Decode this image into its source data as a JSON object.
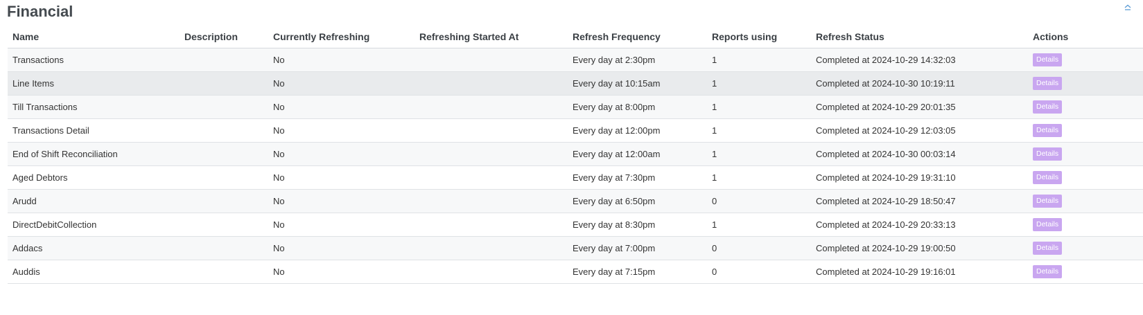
{
  "section": {
    "title": "Financial",
    "collapse_icon": "chevron-up-icon"
  },
  "colors": {
    "button": "#c9a6f0",
    "title": "#444a4f",
    "row_alt": "#f7f8f9",
    "row_hover": "#e9ebed"
  },
  "table": {
    "headers": [
      "Name",
      "Description",
      "Currently Refreshing",
      "Refreshing Started At",
      "Refresh Frequency",
      "Reports using",
      "Refresh Status",
      "Actions"
    ],
    "rows": [
      {
        "name": "Transactions",
        "description": "",
        "refreshing": "No",
        "started": "",
        "frequency": "Every day at 2:30pm",
        "reports": "1",
        "status": "Completed at 2024-10-29 14:32:03",
        "action": "Details"
      },
      {
        "name": "Line Items",
        "description": "",
        "refreshing": "No",
        "started": "",
        "frequency": "Every day at 10:15am",
        "reports": "1",
        "status": "Completed at 2024-10-30 10:19:11",
        "action": "Details"
      },
      {
        "name": "Till Transactions",
        "description": "",
        "refreshing": "No",
        "started": "",
        "frequency": "Every day at 8:00pm",
        "reports": "1",
        "status": "Completed at 2024-10-29 20:01:35",
        "action": "Details"
      },
      {
        "name": "Transactions Detail",
        "description": "",
        "refreshing": "No",
        "started": "",
        "frequency": "Every day at 12:00pm",
        "reports": "1",
        "status": "Completed at 2024-10-29 12:03:05",
        "action": "Details"
      },
      {
        "name": "End of Shift Reconciliation",
        "description": "",
        "refreshing": "No",
        "started": "",
        "frequency": "Every day at 12:00am",
        "reports": "1",
        "status": "Completed at 2024-10-30 00:03:14",
        "action": "Details"
      },
      {
        "name": "Aged Debtors",
        "description": "",
        "refreshing": "No",
        "started": "",
        "frequency": "Every day at 7:30pm",
        "reports": "1",
        "status": "Completed at 2024-10-29 19:31:10",
        "action": "Details"
      },
      {
        "name": "Arudd",
        "description": "",
        "refreshing": "No",
        "started": "",
        "frequency": "Every day at 6:50pm",
        "reports": "0",
        "status": "Completed at 2024-10-29 18:50:47",
        "action": "Details"
      },
      {
        "name": "DirectDebitCollection",
        "description": "",
        "refreshing": "No",
        "started": "",
        "frequency": "Every day at 8:30pm",
        "reports": "1",
        "status": "Completed at 2024-10-29 20:33:13",
        "action": "Details"
      },
      {
        "name": "Addacs",
        "description": "",
        "refreshing": "No",
        "started": "",
        "frequency": "Every day at 7:00pm",
        "reports": "0",
        "status": "Completed at 2024-10-29 19:00:50",
        "action": "Details"
      },
      {
        "name": "Auddis",
        "description": "",
        "refreshing": "No",
        "started": "",
        "frequency": "Every day at 7:15pm",
        "reports": "0",
        "status": "Completed at 2024-10-29 19:16:01",
        "action": "Details"
      }
    ]
  }
}
